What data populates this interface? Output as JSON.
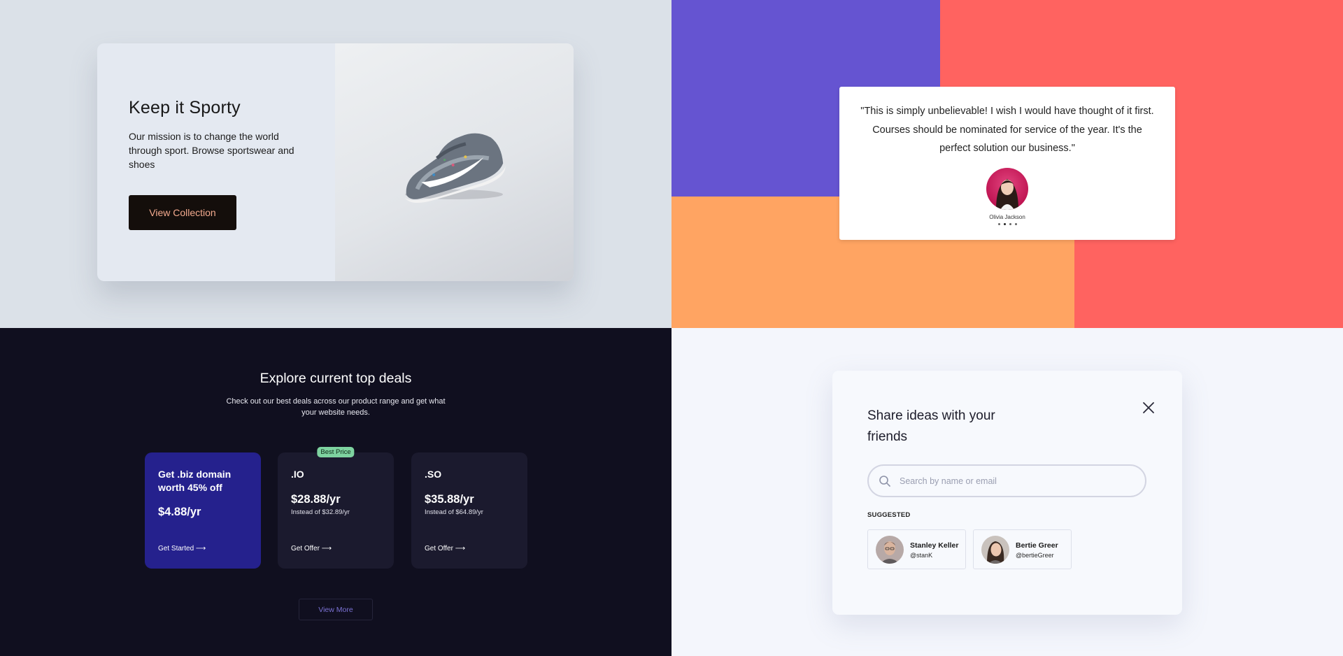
{
  "hero": {
    "title": "Keep it Sporty",
    "description": "Our mission is to change the world through sport. Browse sportswear and shoes",
    "button_label": "View Collection"
  },
  "testimonial": {
    "quote": "\"This is simply unbelievable! I wish I would have thought of it first. Courses should be nominated for service of the year. It's the perfect solution our business.\"",
    "author": "Olivia Jackson",
    "slide_count": 4,
    "active_slide": 2,
    "colors": {
      "purple": "#6554d1",
      "coral": "#ff6360",
      "orange": "#ffa462"
    }
  },
  "deals": {
    "title": "Explore current top deals",
    "subtitle": "Check out our best deals across our product range and get what your website needs.",
    "cards": [
      {
        "name": "Get .biz domain worth 45% off",
        "price": "$4.88/yr",
        "was": "",
        "badge": "",
        "cta": "Get Started ⟶",
        "highlight": true
      },
      {
        "name": ".IO",
        "price": "$28.88/yr",
        "was": "Instead of $32.89/yr",
        "badge": "Best Price",
        "cta": "Get Offer ⟶",
        "highlight": false
      },
      {
        "name": ".SO",
        "price": "$35.88/yr",
        "was": "Instead of $64.89/yr",
        "badge": "",
        "cta": "Get Offer ⟶",
        "highlight": false
      }
    ],
    "view_more_label": "View More",
    "colors": {
      "background": "#100f1f",
      "primary_card": "#25218d",
      "badge": "#7ed3a0"
    }
  },
  "share": {
    "title": "Share ideas with your friends",
    "search_placeholder": "Search by name or email",
    "suggested_label": "SUGGESTED",
    "people": [
      {
        "name": "Stanley Keller",
        "handle": "@stanK"
      },
      {
        "name": "Bertie Greer",
        "handle": "@bertieGreer"
      }
    ],
    "icons": {
      "close": "close-icon",
      "search": "search-icon"
    }
  }
}
